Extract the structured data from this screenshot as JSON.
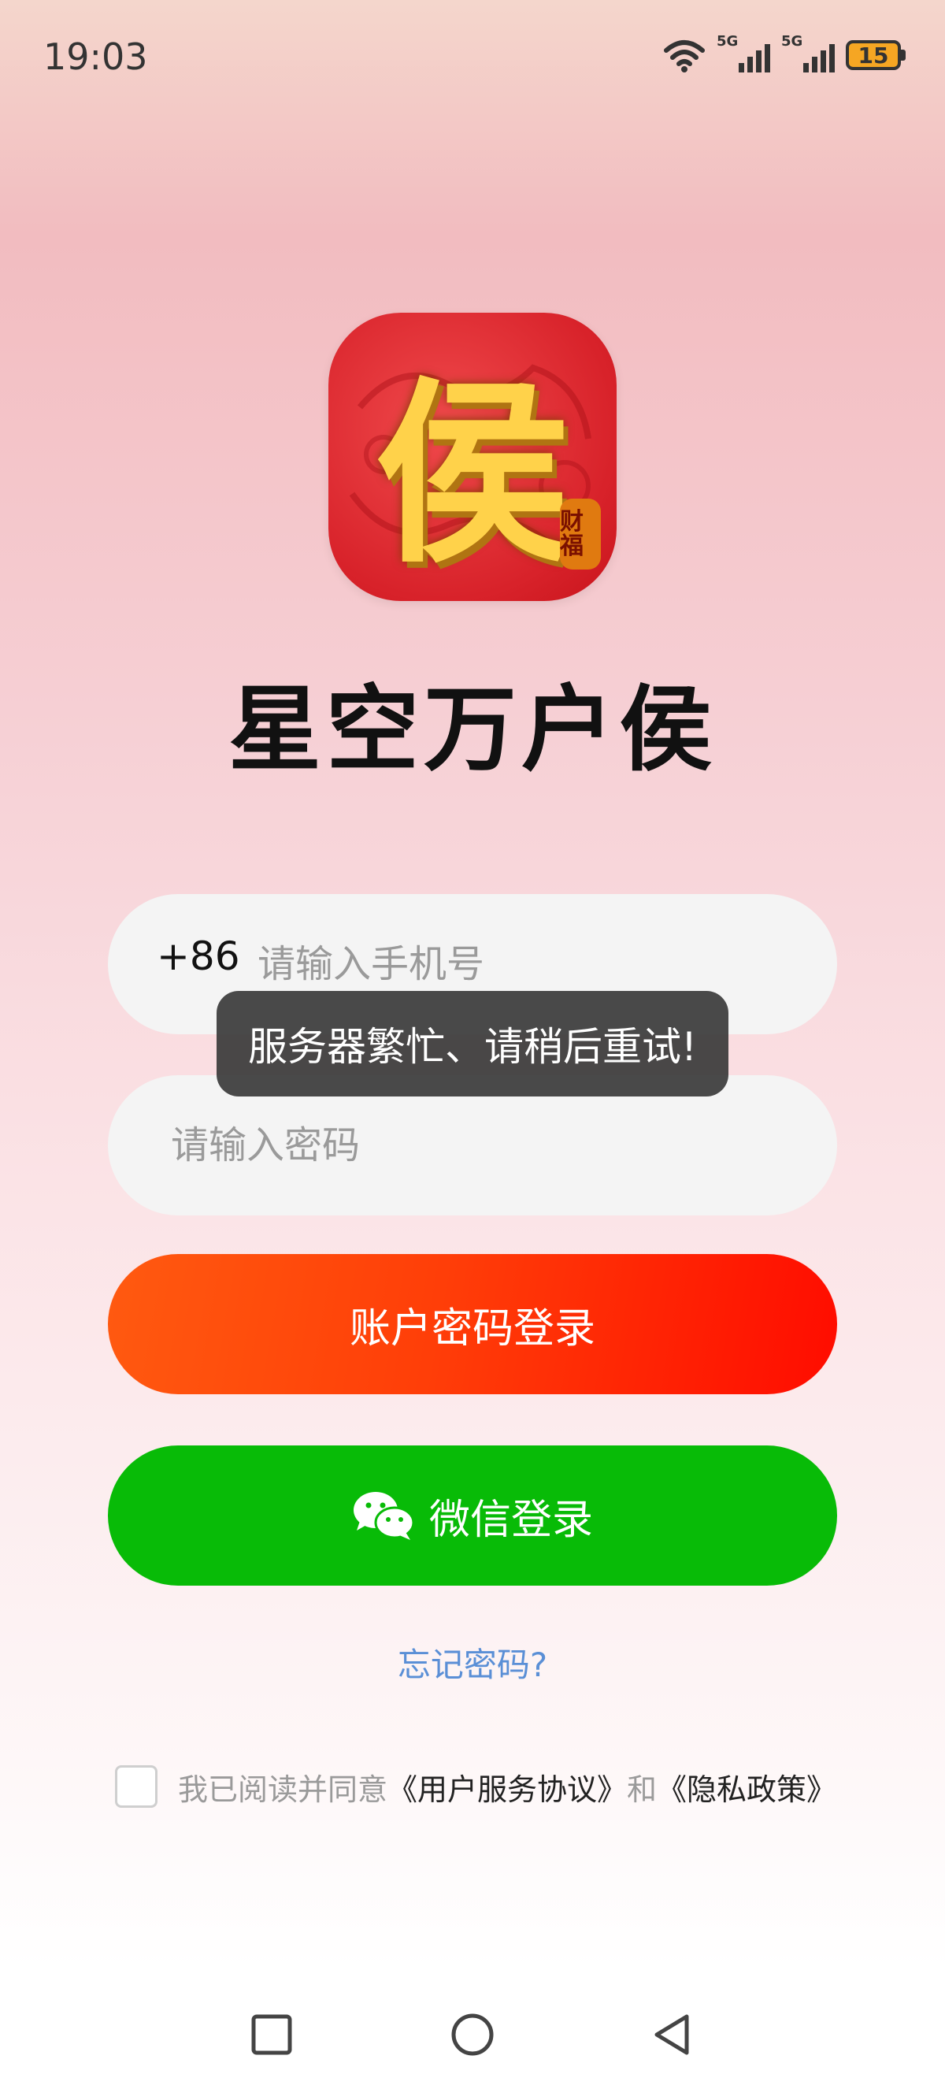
{
  "status_bar": {
    "time": "19:03",
    "signal1_label": "5G",
    "signal2_label": "5G",
    "battery_level": "15",
    "battery_color": "#f5a623"
  },
  "app": {
    "icon_glyph": "侯",
    "icon_seal": "财福",
    "title": "星空万户侯"
  },
  "phone_field": {
    "country_code": "+86",
    "placeholder": "请输入手机号",
    "value": ""
  },
  "password_field": {
    "placeholder": "请输入密码",
    "value": ""
  },
  "toast": {
    "message": "服务器繁忙、请稍后重试!"
  },
  "buttons": {
    "login_label": "账户密码登录",
    "wechat_label": "微信登录",
    "forgot_label": "忘记密码?"
  },
  "agreement": {
    "checked": false,
    "prefix": "我已阅读并同意",
    "terms_link": "《用户服务协议》",
    "and_text": "和",
    "privacy_link": "《隐私政策》"
  },
  "colors": {
    "login_gradient_start": "#ff5a10",
    "login_gradient_end": "#ff0c00",
    "wechat_green": "#08bb07",
    "link_blue": "#5a8fd6"
  },
  "nav_bar": {
    "icons": [
      "recent-apps-icon",
      "home-icon",
      "back-icon"
    ]
  }
}
